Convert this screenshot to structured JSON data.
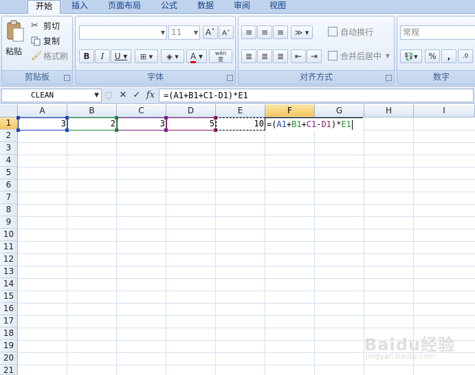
{
  "tabs": [
    "开始",
    "插入",
    "页面布局",
    "公式",
    "数据",
    "审阅",
    "视图"
  ],
  "clipboard": {
    "paste": "粘贴",
    "cut": "剪切",
    "copy": "复制",
    "format_painter": "格式刷",
    "label": "剪贴板"
  },
  "font": {
    "size": "11",
    "label": "字体",
    "phonetic": "wén\n变"
  },
  "alignment": {
    "wrap": "自动换行",
    "merge": "合并后居中",
    "label": "对齐方式"
  },
  "number": {
    "format": "常规",
    "percent": "%",
    "comma": ",",
    "label": "数字"
  },
  "formula_bar": {
    "name_box": "CLEAN",
    "cancel": "✕",
    "enter": "✓",
    "fx": "fx",
    "formula": "=(A1+B1+C1-D1)*E1"
  },
  "columns": [
    "A",
    "B",
    "C",
    "D",
    "E",
    "F",
    "G",
    "H",
    "I"
  ],
  "rows": [
    "1",
    "2",
    "3",
    "4",
    "5",
    "6",
    "7",
    "8",
    "9",
    "10",
    "11",
    "12",
    "13",
    "14",
    "15",
    "16",
    "17",
    "18",
    "19",
    "20",
    "21"
  ],
  "cells": {
    "A1": "3",
    "B1": "2",
    "C1": "3",
    "D1": "5",
    "E1": "10"
  },
  "editing_formula": {
    "p1": "=(",
    "a1": "A1",
    "plus1": "+",
    "b1": "B1",
    "plus2": "+",
    "c1": "C1",
    "minus": "-",
    "d1": "D1",
    "close": ")*",
    "e1": "E1"
  },
  "ref_colors": {
    "A1": "#1f3fbf",
    "B1": "#1f8f2f",
    "C1": "#7a1f8f",
    "D1": "#8f1f6a",
    "E1": "#000000"
  },
  "watermark": {
    "main": "Baidu经验",
    "sub": "jingyan.baidu.com"
  }
}
